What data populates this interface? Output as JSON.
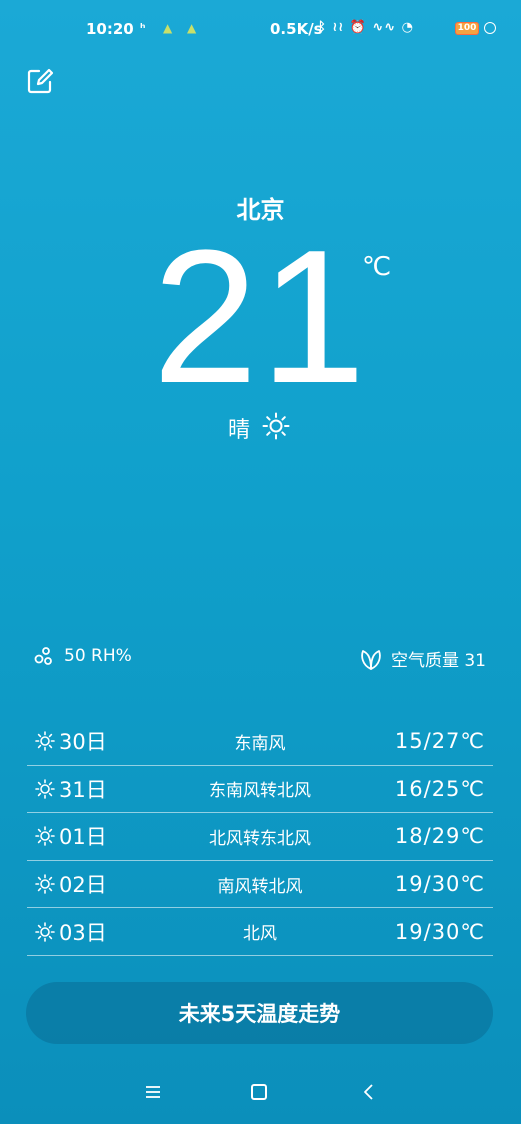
{
  "status_bar": {
    "time": "10:20",
    "network_speed": "0.5K/s",
    "icons": [
      "notification-icon",
      "warning-icon",
      "warning-icon",
      "bluetooth-icon",
      "vibrate-icon",
      "alarm-icon",
      "signal-icon",
      "wifi-icon",
      "battery-icon"
    ],
    "battery": "100"
  },
  "current": {
    "city": "北京",
    "temperature": "21",
    "unit": "℃",
    "condition": "晴"
  },
  "details": {
    "humidity": "50 RH%",
    "air_quality": "空气质量 31"
  },
  "forecast": [
    {
      "day": "30日",
      "wind": "东南风",
      "temp": "15/27℃",
      "icon": "sun-icon"
    },
    {
      "day": "31日",
      "wind": "东南风转北风",
      "temp": "16/25℃",
      "icon": "sun-icon"
    },
    {
      "day": "01日",
      "wind": "北风转东北风",
      "temp": "18/29℃",
      "icon": "sun-icon"
    },
    {
      "day": "02日",
      "wind": "南风转北风",
      "temp": "19/30℃",
      "icon": "sun-icon"
    },
    {
      "day": "03日",
      "wind": "北风",
      "temp": "19/30℃",
      "icon": "sun-icon"
    }
  ],
  "trend_button": "未来5天温度走势",
  "colors": {
    "background_top": "#1ba9d6",
    "background_bottom": "#0b8fbb",
    "text": "#ffffff",
    "button_bg": "#0a6e96"
  }
}
